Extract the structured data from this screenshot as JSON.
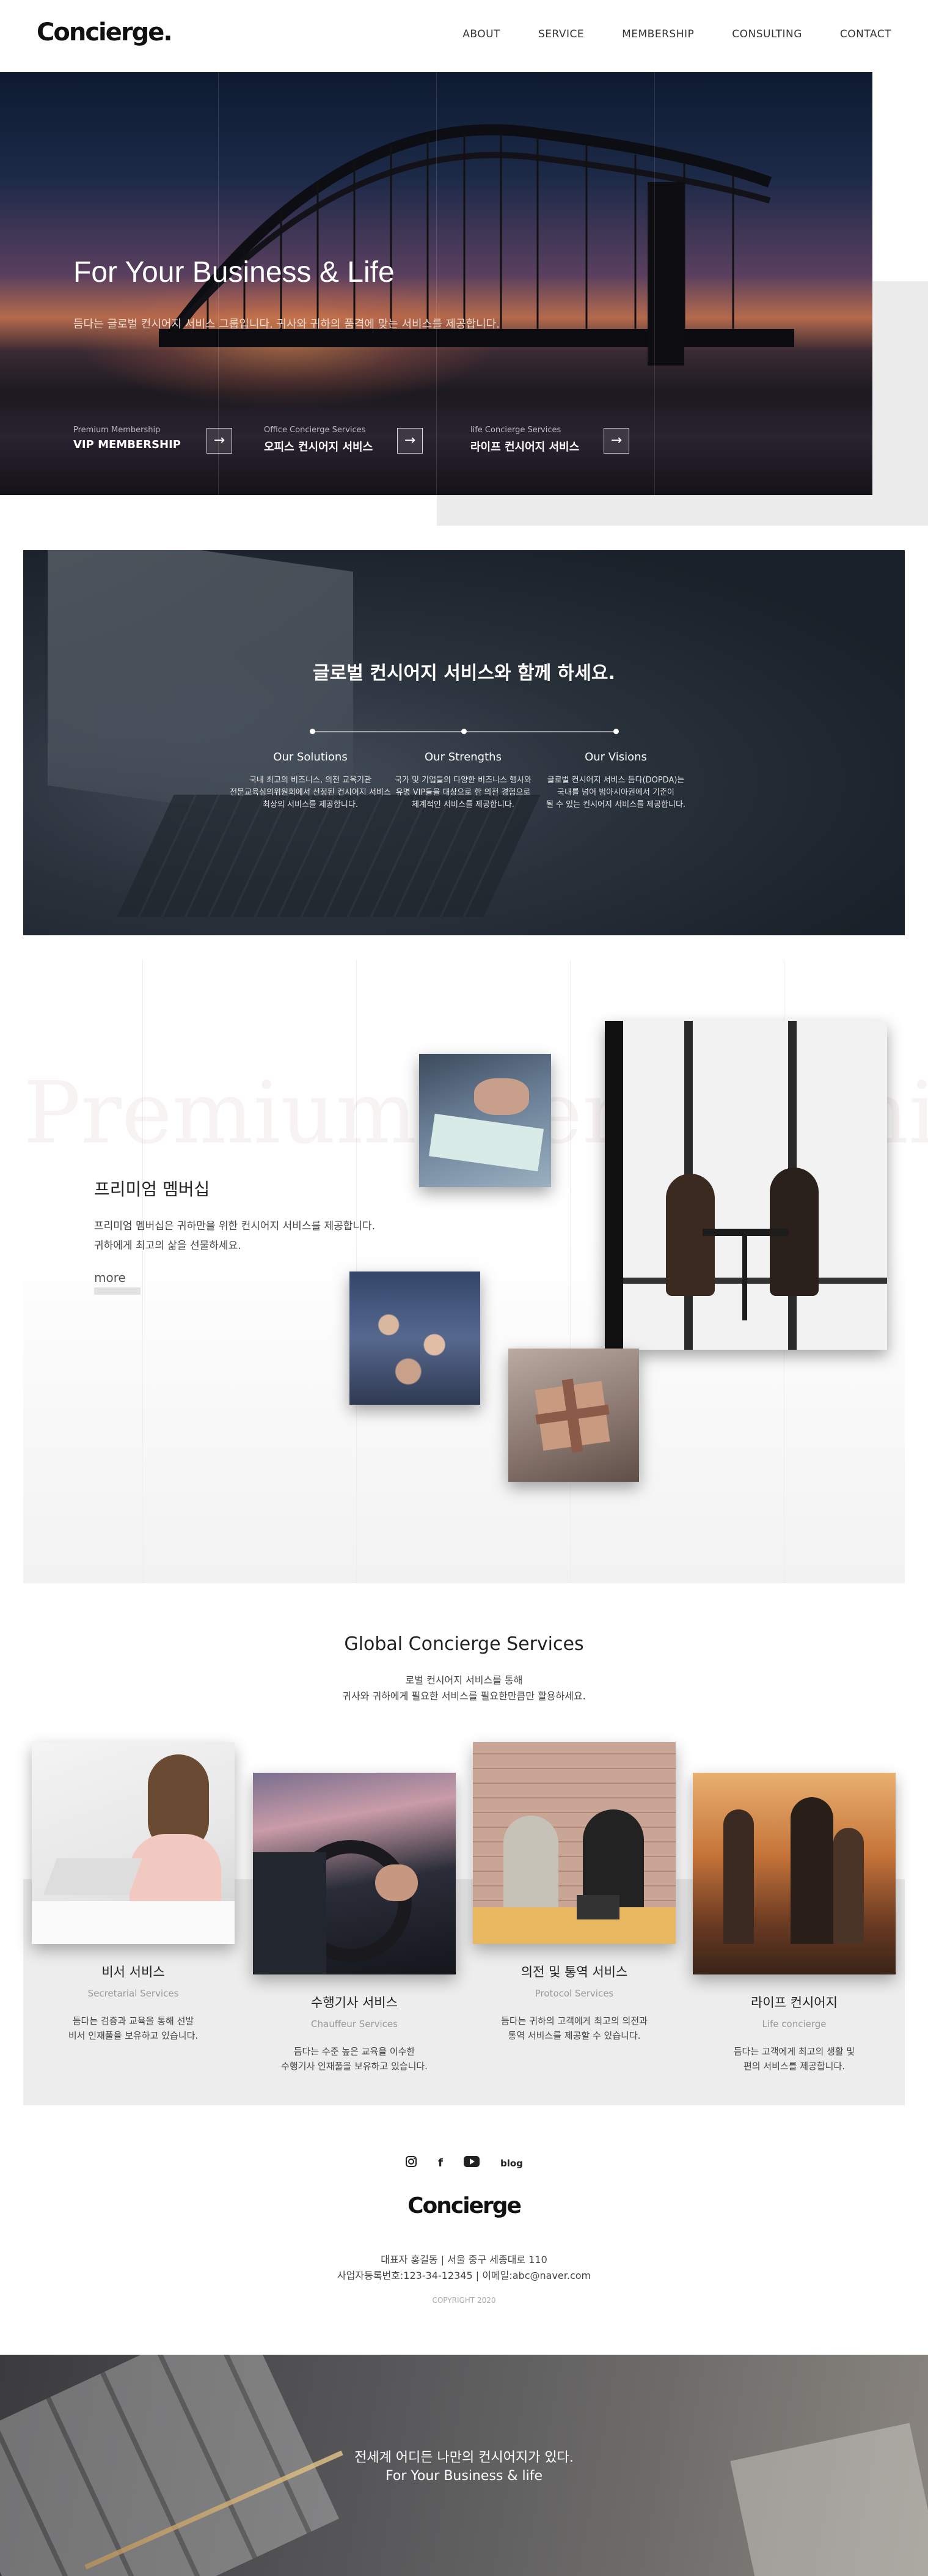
{
  "header": {
    "logo": "Concierge.",
    "nav": [
      "ABOUT",
      "SERVICE",
      "MEMBERSHIP",
      "CONSULTING",
      "CONTACT"
    ]
  },
  "hero": {
    "title": "For Your Business & Life",
    "subtitle": "듬다는 글로벌 컨시어지 서비스 그룹입니다. 귀사와 귀하의 품격에 맞는 서비스를 제공합니다.",
    "services": [
      {
        "small": "Premium Membership",
        "big": "VIP MEMBERSHIP"
      },
      {
        "small": "Office Concierge Services",
        "big": "오피스 컨시어지 서비스"
      },
      {
        "small": "life Concierge Services",
        "big": "라이프 컨시어지 서비스"
      }
    ]
  },
  "global": {
    "title": "글로벌 컨시어지 서비스와 함께 하세요.",
    "cols": [
      {
        "title": "Our Solutions",
        "desc": "국내 최고의 비즈니스, 의전 교육기관\n전문교육심의위원회에서 선정된 컨시어지 서비스\n최상의 서비스를 제공합니다."
      },
      {
        "title": "Our Strengths",
        "desc": "국가 및 기업들의 다양한 비즈니스 행사와\n유명 VIP들을 대상으로 한 의전 경험으로\n체계적인 서비스를 제공합니다."
      },
      {
        "title": "Our Visions",
        "desc": "글로벌 컨시어지 서비스 듬다(DOPDA)는\n국내를 넘어 범아시아권에서 기준이\n될 수 있는 컨시어지 서비스를 제공합니다."
      }
    ]
  },
  "premium": {
    "bg_text": "Premium Membership",
    "title": "프리미엄 멤버십",
    "desc1": "프리미엄 멤버십은 귀하만을 위한 컨시어지 서비스를 제공합니다.",
    "desc2": "귀하에게 최고의 삶을 선물하세요.",
    "more": "more"
  },
  "services": {
    "title": "Global Concierge Services",
    "desc1": "로벌 컨시어지 서비스를 통해",
    "desc2": "귀사와 귀하에게 필요한 서비스를 필요한만큼만 활용하세요.",
    "cards": [
      {
        "name": "비서 서비스",
        "en": "Secretarial Services",
        "txt1": "듬다는 검증과 교육을 통해 선발",
        "txt2": "비서 인재풀을 보유하고 있습니다."
      },
      {
        "name": "수행기사 서비스",
        "en": "Chauffeur Services",
        "txt1": "듬다는 수준 높은 교육을 이수한",
        "txt2": "수행기사 인재풀을 보유하고 있습니다."
      },
      {
        "name": "의전 및 통역 서비스",
        "en": "Protocol Services",
        "txt1": "듬다는 귀하의 고객에게 최고의 의전과",
        "txt2": "통역 서비스를 제공할 수 있습니다."
      },
      {
        "name": "라이프 컨시어지",
        "en": "Life concierge",
        "txt1": "듬다는 고객에게 최고의 생활 및",
        "txt2": "편의 서비스를 제공합니다."
      }
    ]
  },
  "footer": {
    "social": {
      "blog": "blog"
    },
    "logo": "Concierge",
    "info1": "대표자 홍길동 | 서울 중구 세종대로 110",
    "info2": "사업자등록번호:123-34-12345 | 이메일:abc@naver.com",
    "copyright": "COPYRIGHT 2020"
  },
  "bottom": {
    "line1": "전세계 어디든 나만의 컨시어지가 있다.",
    "line2": "For Your Business & life"
  }
}
